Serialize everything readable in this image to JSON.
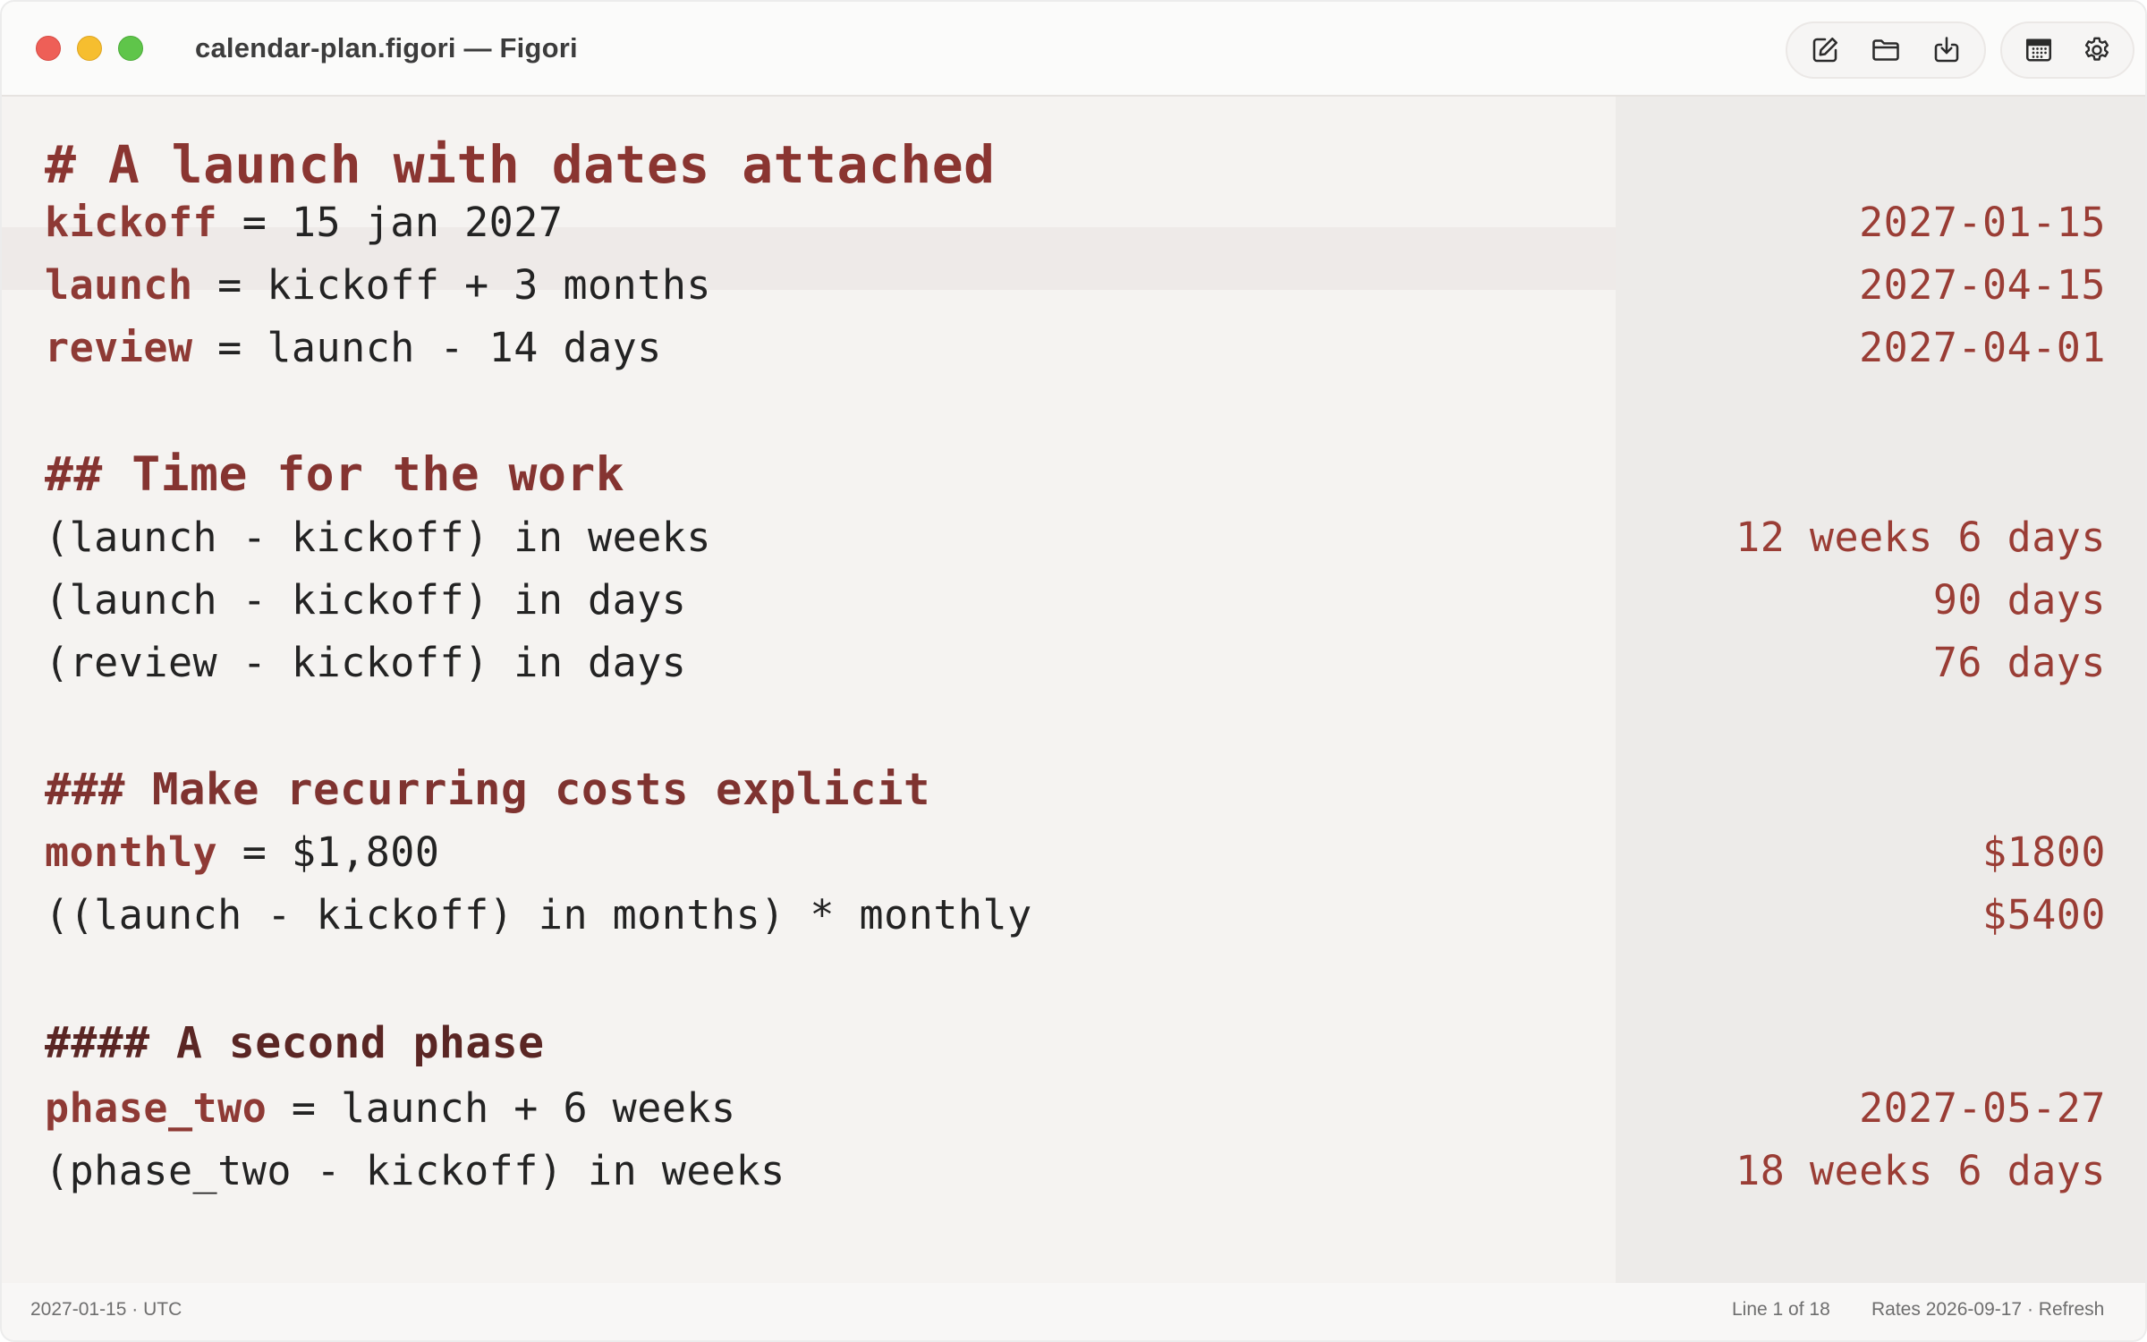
{
  "window": {
    "title": "calendar-plan.figori — Figori"
  },
  "toolbar": {
    "icons": [
      "new-note-icon",
      "open-folder-icon",
      "export-icon",
      "calendar-icon",
      "settings-icon"
    ]
  },
  "editor": {
    "lines": [
      {
        "type": "heading",
        "text": "# A launch with dates attached"
      },
      {
        "type": "assign",
        "var": "kickoff",
        "expr": " = 15 jan 2027",
        "result": "2027-01-15"
      },
      {
        "type": "assign",
        "var": "launch",
        "expr": " = kickoff + 3 months",
        "result": "2027-04-15"
      },
      {
        "type": "assign",
        "var": "review",
        "expr": " = launch - 14 days",
        "result": "2027-04-01"
      },
      {
        "type": "heading",
        "text": "## Time for the work"
      },
      {
        "type": "expr",
        "expr": "(launch - kickoff) in weeks",
        "result": "12 weeks 6 days"
      },
      {
        "type": "expr",
        "expr": "(launch - kickoff) in days",
        "result": "90 days"
      },
      {
        "type": "expr",
        "expr": "(review - kickoff) in days",
        "result": "76 days"
      },
      {
        "type": "heading",
        "text": "### Make recurring costs explicit"
      },
      {
        "type": "assign",
        "var": "monthly",
        "expr": " = $1,800",
        "result": "$1800"
      },
      {
        "type": "expr",
        "expr": "((launch - kickoff) in months) * monthly",
        "result": "$5400"
      },
      {
        "type": "heading",
        "text": "#### A second phase"
      },
      {
        "type": "assign",
        "var": "phase_two",
        "expr": " = launch + 6 weeks",
        "result": "2027-05-27"
      },
      {
        "type": "expr",
        "expr": "(phase_two - kickoff) in weeks",
        "result": "18 weeks 6 days"
      }
    ]
  },
  "status": {
    "left": "2027-01-15 · UTC",
    "line": "Line 1 of 18",
    "rates": "Rates 2026-09-17 · Refresh"
  },
  "colors": {
    "accent": "#8e3a35",
    "result": "#9a3d35",
    "editor_bg": "#f5f3f1",
    "results_bg": "#edebe9"
  }
}
